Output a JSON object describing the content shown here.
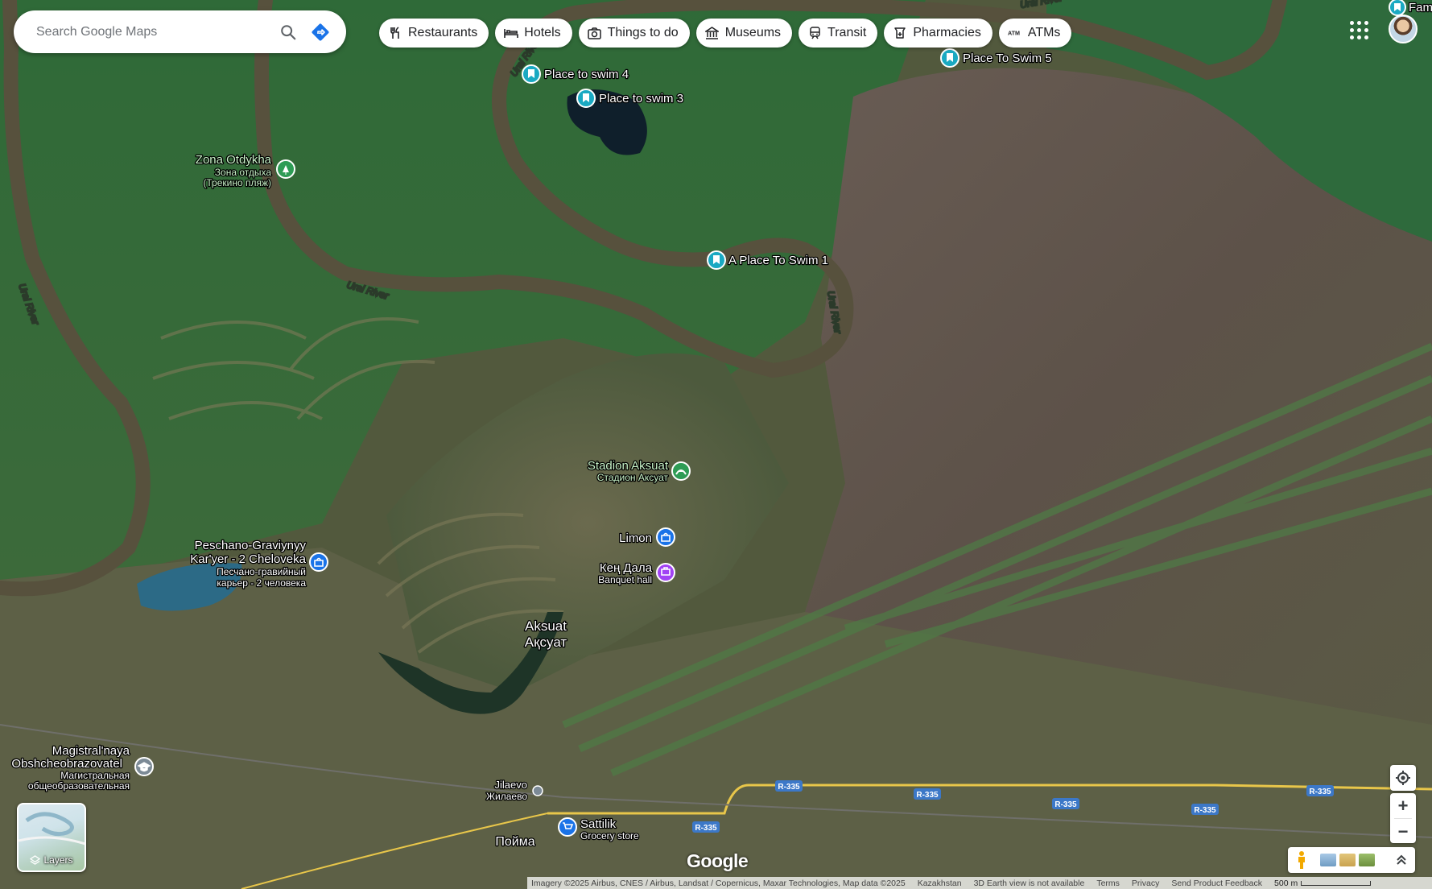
{
  "search": {
    "placeholder": "Search Google Maps"
  },
  "chips": [
    {
      "label": "Restaurants",
      "icon": "fork-knife-icon"
    },
    {
      "label": "Hotels",
      "icon": "bed-icon"
    },
    {
      "label": "Things to do",
      "icon": "camera-icon"
    },
    {
      "label": "Museums",
      "icon": "museum-icon"
    },
    {
      "label": "Transit",
      "icon": "train-icon"
    },
    {
      "label": "Pharmacies",
      "icon": "pharmacy-icon"
    },
    {
      "label": "ATMs",
      "icon": "atm-icon"
    }
  ],
  "places": {
    "swim4": "Place to swim 4",
    "swim3": "Place to swim 3",
    "swim5": "Place To Swim 5",
    "swim1": "A Place To Swim 1",
    "fam": "Fam",
    "zona": "Zona Otdykha",
    "zona_ru1": "Зона отдыха",
    "zona_ru2": "(Трекино пляж)",
    "stadion": "Stadion Aksuat",
    "stadion_ru": "Стадион Аксуат",
    "limon": "Limon",
    "keng": "Кең Дала",
    "keng_sub": "Banquet hall",
    "pesch1": "Peschano-Graviynyy",
    "pesch2": "Kar'yer - 2 Cheloveka",
    "pesch_ru1": "Песчано-гравийный",
    "pesch_ru2": "карьер - 2 человека",
    "aksuat": "Aksuat",
    "aksuat_kz": "Ақсуат",
    "mag1": "Magistral'naya",
    "mag2": "Obshcheobrazovatel",
    "mag_ru1": "Магистральная",
    "mag_ru2": "общеобразовательная",
    "jilaevo": "Jilaevo",
    "jilaevo_ru": "Жилаево",
    "sattilik": "Sattilik",
    "sattilik_sub": "Grocery store",
    "poyma": "Пойма"
  },
  "rivers": {
    "r1": "Ural River",
    "r2": "Ural River",
    "r3": "Ural River",
    "r4": "Ural River",
    "r5": "Ural River"
  },
  "roads": [
    "R-335",
    "R-335",
    "R-335",
    "R-335",
    "R-335",
    "R-335"
  ],
  "controls": {
    "layers_label": "Layers",
    "zoom_in": "+",
    "zoom_out": "−",
    "google": "Google"
  },
  "attribution": {
    "imagery": "Imagery ©2025 Airbus, CNES / Airbus, Landsat / Copernicus, Maxar Technologies, Map data ©2025",
    "country": "Kazakhstan",
    "earth": "3D Earth view is not available",
    "terms": "Terms",
    "privacy": "Privacy",
    "feedback": "Send Product Feedback",
    "scale": "500 m"
  },
  "colors": {
    "pin_swim": "#1aa9c2",
    "pin_green": "#2e9c55",
    "pin_blue": "#1a73e8",
    "pin_purple": "#a142f4",
    "directions": "#1a73e8"
  }
}
